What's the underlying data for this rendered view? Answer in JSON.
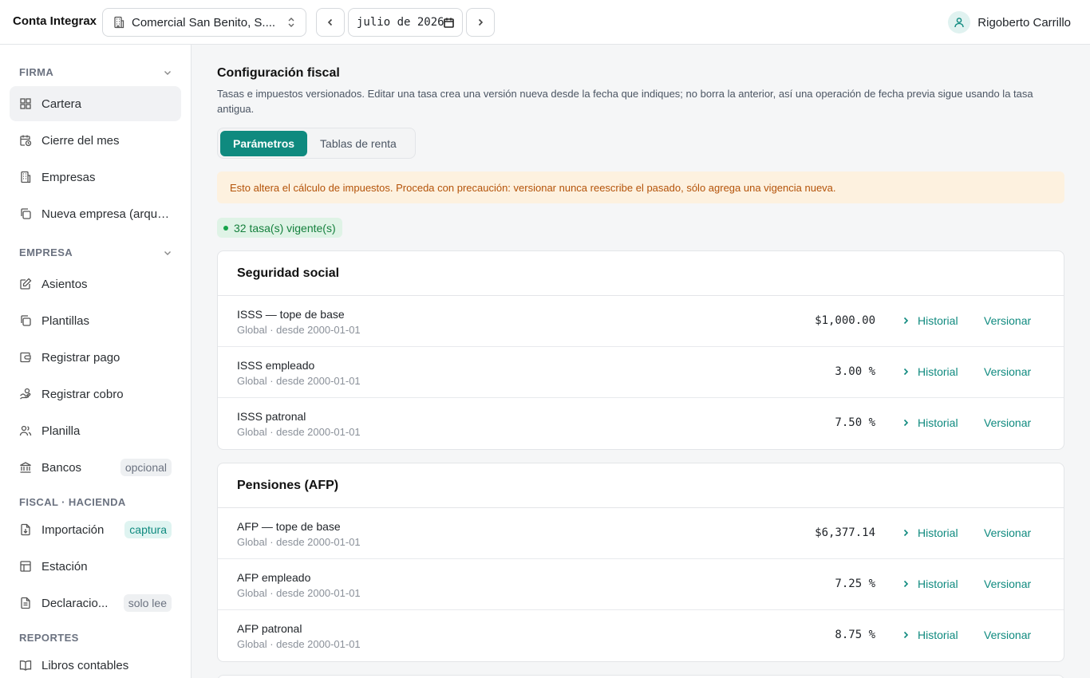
{
  "header": {
    "brand": "Conta Integrax",
    "company": "Comercial San Benito, S....",
    "date_value": "julio de 2026",
    "user_name": "Rigoberto Carrillo"
  },
  "sidebar": {
    "sections": [
      {
        "title": "FIRMA",
        "collapsible": true
      },
      {
        "title": "EMPRESA",
        "collapsible": true
      },
      {
        "title": "FISCAL · HACIENDA",
        "collapsible": false
      },
      {
        "title": "REPORTES",
        "collapsible": false
      }
    ],
    "items": [
      {
        "label": "Cartera",
        "icon": "grid-icon",
        "active": true
      },
      {
        "label": "Cierre del mes",
        "icon": "calendar-clock-icon"
      },
      {
        "label": "Empresas",
        "icon": "building-icon"
      },
      {
        "label": "Nueva empresa (arque...",
        "icon": "copy-icon"
      },
      {
        "label": "Asientos",
        "icon": "edit-note-icon"
      },
      {
        "label": "Plantillas",
        "icon": "copy-icon"
      },
      {
        "label": "Registrar pago",
        "icon": "wallet-icon"
      },
      {
        "label": "Registrar cobro",
        "icon": "hand-coins-icon"
      },
      {
        "label": "Planilla",
        "icon": "users-icon"
      },
      {
        "label": "Bancos",
        "icon": "bank-icon",
        "badge": "opcional"
      },
      {
        "label": "Importación",
        "icon": "file-import-icon",
        "badge": "captura"
      },
      {
        "label": "Estación",
        "icon": "table-icon"
      },
      {
        "label": "Declaracio...",
        "icon": "document-icon",
        "badge": "solo lee"
      },
      {
        "label": "Libros contables",
        "icon": "book-icon"
      }
    ]
  },
  "main": {
    "title": "Configuración fiscal",
    "description": "Tasas e impuestos versionados. Editar una tasa crea una versión nueva desde la fecha que indiques; no borra la anterior, así una operación de fecha previa sigue usando la tasa antigua.",
    "tabs": [
      "Parámetros",
      "Tablas de renta"
    ],
    "warning": "Esto altera el cálculo de impuestos. Proceda con precaución: versionar nunca reescribe el pasado, sólo agrega una vigencia nueva.",
    "count_label": "32 tasa(s) vigente(s)",
    "history_label": "Historial",
    "version_label": "Versionar",
    "groups": [
      {
        "title": "Seguridad social",
        "rows": [
          {
            "name": "ISSS — tope de base",
            "scope": "Global · desde 2000-01-01",
            "value": "$1,000.00"
          },
          {
            "name": "ISSS empleado",
            "scope": "Global · desde 2000-01-01",
            "value": "3.00 %"
          },
          {
            "name": "ISSS patronal",
            "scope": "Global · desde 2000-01-01",
            "value": "7.50 %"
          }
        ]
      },
      {
        "title": "Pensiones (AFP)",
        "rows": [
          {
            "name": "AFP — tope de base",
            "scope": "Global · desde 2000-01-01",
            "value": "$6,377.14"
          },
          {
            "name": "AFP empleado",
            "scope": "Global · desde 2000-01-01",
            "value": "7.25 %"
          },
          {
            "name": "AFP patronal",
            "scope": "Global · desde 2000-01-01",
            "value": "8.75 %"
          }
        ]
      }
    ]
  },
  "colors": {
    "accent": "#0f8a7f",
    "warning_bg": "#fdf1df",
    "warning_text": "#b45309"
  }
}
